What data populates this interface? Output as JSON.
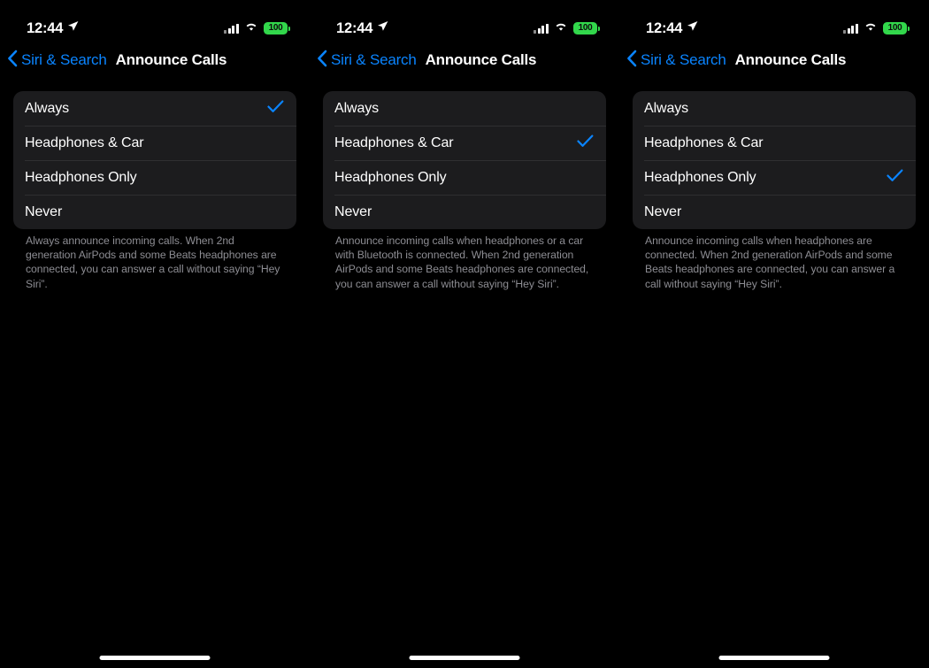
{
  "meta": {
    "accent_blue": "#0A84FF",
    "battery_green": "#32D74B",
    "card_bg": "#1C1C1E",
    "screen_bg": "#000000",
    "footer_text_color": "#8D8D93"
  },
  "status_bar": {
    "time": "12:44",
    "location_icon": "location-arrow-icon",
    "cellular_icon": "cellular-signal-icon",
    "wifi_icon": "wifi-icon",
    "battery_percent": "100"
  },
  "nav": {
    "back_icon": "chevron-left-icon",
    "back_label": "Siri & Search",
    "title": "Announce Calls"
  },
  "options": [
    "Always",
    "Headphones & Car",
    "Headphones Only",
    "Never"
  ],
  "checkmark_icon": "checkmark-icon",
  "panels": [
    {
      "id": "panel-always",
      "selected_index": 0,
      "selected_label": "Always",
      "footer": "Always announce incoming calls. When 2nd generation AirPods and some Beats headphones are connected, you can answer a call without saying “Hey Siri”."
    },
    {
      "id": "panel-headphones-and-car",
      "selected_index": 1,
      "selected_label": "Headphones & Car",
      "footer": "Announce incoming calls when headphones or a car with Bluetooth is connected. When 2nd generation AirPods and some Beats headphones are connected, you can answer a call without saying “Hey Siri”."
    },
    {
      "id": "panel-headphones-only",
      "selected_index": 2,
      "selected_label": "Headphones Only",
      "footer": "Announce incoming calls when headphones are connected. When 2nd generation AirPods and some Beats headphones are connected, you can answer a call without saying “Hey Siri”."
    }
  ]
}
